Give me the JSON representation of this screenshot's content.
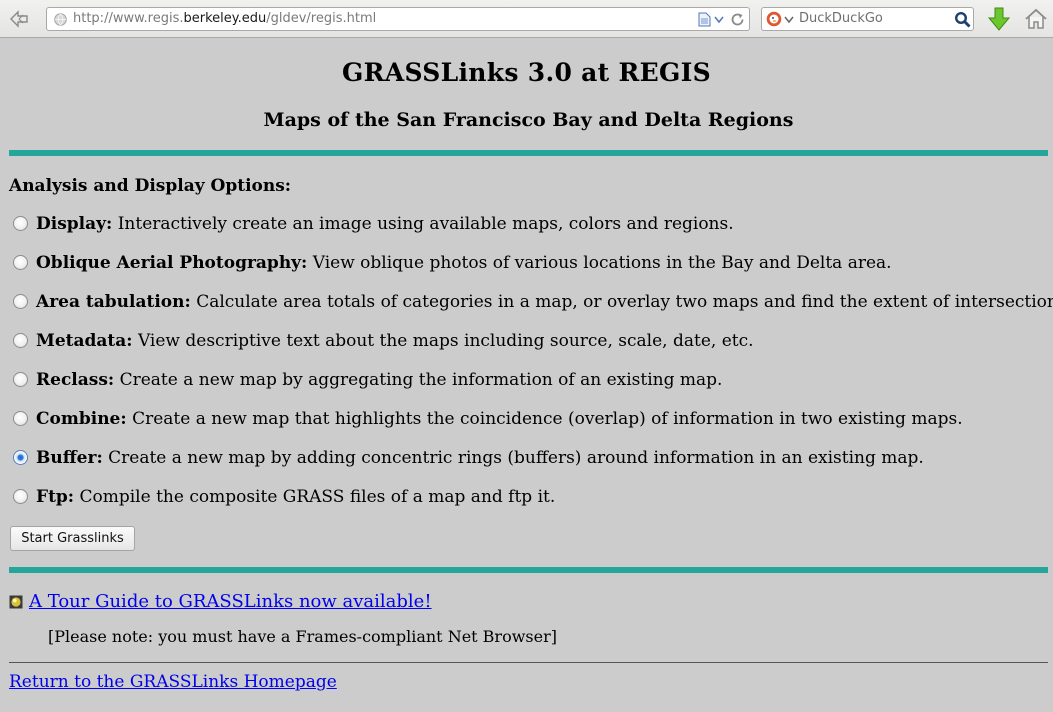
{
  "browser": {
    "url_prefix": "http://www.regis.",
    "url_domain": "berkeley.edu",
    "url_path": "/gldev/regis.html",
    "search_placeholder": "DuckDuckGo"
  },
  "page": {
    "title": "GRASSLinks 3.0 at REGIS",
    "subtitle": "Maps of the San Francisco Bay and Delta Regions",
    "options_heading": "Analysis and Display Options:",
    "options": [
      {
        "label": "Display:",
        "desc": "Interactively create an image using available maps, colors and regions.",
        "checked": false
      },
      {
        "label": "Oblique Aerial Photography:",
        "desc": "View oblique photos of various locations in the Bay and Delta area.",
        "checked": false
      },
      {
        "label": "Area tabulation:",
        "desc": "Calculate area totals of categories in a map, or overlay two maps and find the extent of intersection.",
        "checked": false
      },
      {
        "label": "Metadata:",
        "desc": "View descriptive text about the maps including source, scale, date, etc.",
        "checked": false
      },
      {
        "label": "Reclass:",
        "desc": "Create a new map by aggregating the information of an existing map.",
        "checked": false
      },
      {
        "label": "Combine:",
        "desc": "Create a new map that highlights the coincidence (overlap) of information in two existing maps.",
        "checked": false
      },
      {
        "label": "Buffer:",
        "desc": "Create a new map by adding concentric rings (buffers) around information in an existing map.",
        "checked": true
      },
      {
        "label": "Ftp:",
        "desc": "Compile the composite GRASS files of a map and ftp it.",
        "checked": false
      }
    ],
    "start_button": "Start Grasslinks",
    "tour_link": "A Tour Guide to GRASSLinks now available!",
    "note": "[Please note: you must have a Frames-compliant Net Browser]",
    "home_link": "Return to the GRASSLinks Homepage"
  },
  "colors": {
    "rule": "#26a59a",
    "link": "#0000ee",
    "background": "#cccccc"
  }
}
